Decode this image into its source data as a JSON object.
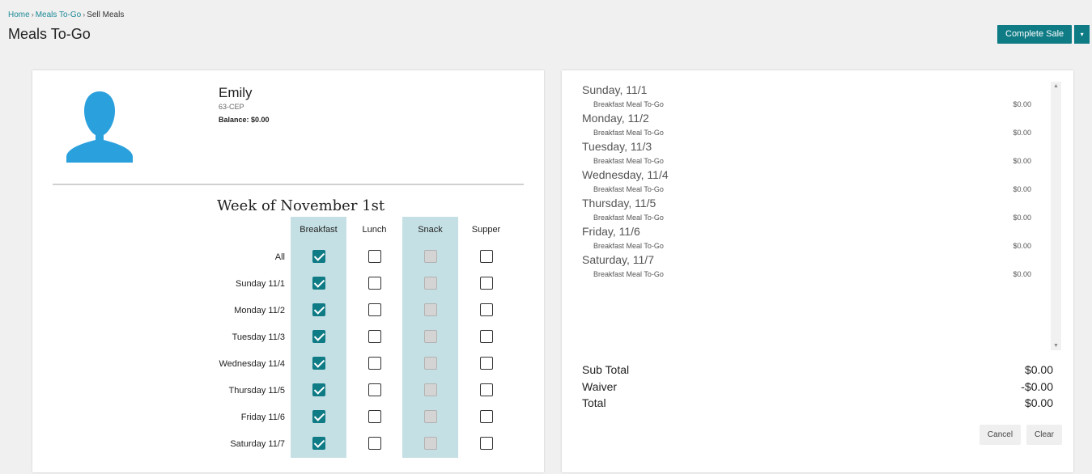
{
  "breadcrumb": {
    "home": "Home",
    "meals": "Meals To-Go",
    "current": "Sell Meals",
    "separator": "›"
  },
  "page_title": "Meals To-Go",
  "actions": {
    "complete_label": "Complete Sale",
    "caret": "▾"
  },
  "student": {
    "name": "Emily",
    "account": "63-CEP",
    "balance": "Balance: $0.00",
    "avatar_icon": "person-silhouette-icon"
  },
  "week": {
    "title": "Week of November 1st",
    "columns": [
      "Breakfast",
      "Lunch",
      "Snack",
      "Supper"
    ],
    "rows": [
      {
        "label": "All",
        "breakfast": true,
        "lunch": false,
        "snack": false,
        "supper": false
      },
      {
        "label": "Sunday 11/1",
        "breakfast": true,
        "lunch": false,
        "snack": false,
        "supper": false
      },
      {
        "label": "Monday 11/2",
        "breakfast": true,
        "lunch": false,
        "snack": false,
        "supper": false
      },
      {
        "label": "Tuesday 11/3",
        "breakfast": true,
        "lunch": false,
        "snack": false,
        "supper": false
      },
      {
        "label": "Wednesday 11/4",
        "breakfast": true,
        "lunch": false,
        "snack": false,
        "supper": false
      },
      {
        "label": "Thursday 11/5",
        "breakfast": true,
        "lunch": false,
        "snack": false,
        "supper": false
      },
      {
        "label": "Friday 11/6",
        "breakfast": true,
        "lunch": false,
        "snack": false,
        "supper": false
      },
      {
        "label": "Saturday 11/7",
        "breakfast": true,
        "lunch": false,
        "snack": false,
        "supper": false
      }
    ],
    "snack_disabled": true
  },
  "cart": {
    "days": [
      {
        "title": "Sunday, 11/1",
        "item": "Breakfast Meal To-Go",
        "price": "$0.00"
      },
      {
        "title": "Monday, 11/2",
        "item": "Breakfast Meal To-Go",
        "price": "$0.00"
      },
      {
        "title": "Tuesday, 11/3",
        "item": "Breakfast Meal To-Go",
        "price": "$0.00"
      },
      {
        "title": "Wednesday, 11/4",
        "item": "Breakfast Meal To-Go",
        "price": "$0.00"
      },
      {
        "title": "Thursday, 11/5",
        "item": "Breakfast Meal To-Go",
        "price": "$0.00"
      },
      {
        "title": "Friday, 11/6",
        "item": "Breakfast Meal To-Go",
        "price": "$0.00"
      },
      {
        "title": "Saturday, 11/7",
        "item": "Breakfast Meal To-Go",
        "price": "$0.00"
      }
    ]
  },
  "totals": {
    "subtotal_label": "Sub Total",
    "subtotal": "$0.00",
    "waiver_label": "Waiver",
    "waiver": "-$0.00",
    "total_label": "Total",
    "total": "$0.00"
  },
  "buttons": {
    "cancel": "Cancel",
    "clear": "Clear"
  },
  "colors": {
    "accent": "#0e7b85",
    "column_shade": "#c5e0e4",
    "link": "#1c8a96",
    "avatar": "#2aa0dd"
  }
}
